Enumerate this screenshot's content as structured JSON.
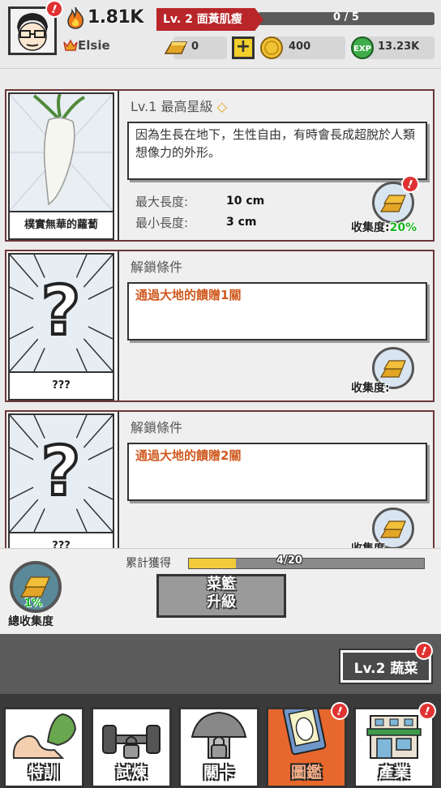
{
  "player": {
    "power": "1.81K",
    "name": "Elsie"
  },
  "level": {
    "title": "Lv. 2 面黃肌瘦",
    "progress": "0 / 5",
    "progress_fraction": 0.0
  },
  "resources": {
    "gold_bars": "0",
    "coins": "400",
    "exp": "13.23K"
  },
  "cards": [
    {
      "name": "樸實無華的蘿蔔",
      "title": "Lv.1  最高星級",
      "description": "因為生長在地下，生性自由，有時會長成超脫於人類想像力的外形。",
      "max_label": "最大長度:",
      "max_value": "10 cm",
      "min_label": "最小長度:",
      "min_value": "3 cm",
      "collect_label": "收集度:",
      "collect_pct": "20%"
    },
    {
      "name": "???",
      "title": "解鎖條件",
      "condition": "通過大地的饋贈1關",
      "collect_label": "收集度:"
    },
    {
      "name": "???",
      "title": "解鎖條件",
      "condition": "通過大地的饋贈2關",
      "collect_label": "收集度"
    }
  ],
  "accumulate": {
    "label": "累計獲得",
    "progress": "4/20",
    "fraction": 0.2
  },
  "upgrade_button": {
    "line1": "菜籃",
    "line2": "升級"
  },
  "total_collect": {
    "pct": "1%",
    "label": "總收集度"
  },
  "veg_level_button": "Lv.2 蔬菜",
  "nav": [
    {
      "label": "特訓",
      "active": false
    },
    {
      "label": "試煉",
      "active": false
    },
    {
      "label": "關卡",
      "active": false
    },
    {
      "label": "圖鑑",
      "active": true
    },
    {
      "label": "產業",
      "active": false
    }
  ],
  "colors": {
    "accent_red": "#b8262a",
    "active_tab": "#e8672c",
    "collect_green": "#19b51e",
    "condition_orange": "#d05a20"
  }
}
